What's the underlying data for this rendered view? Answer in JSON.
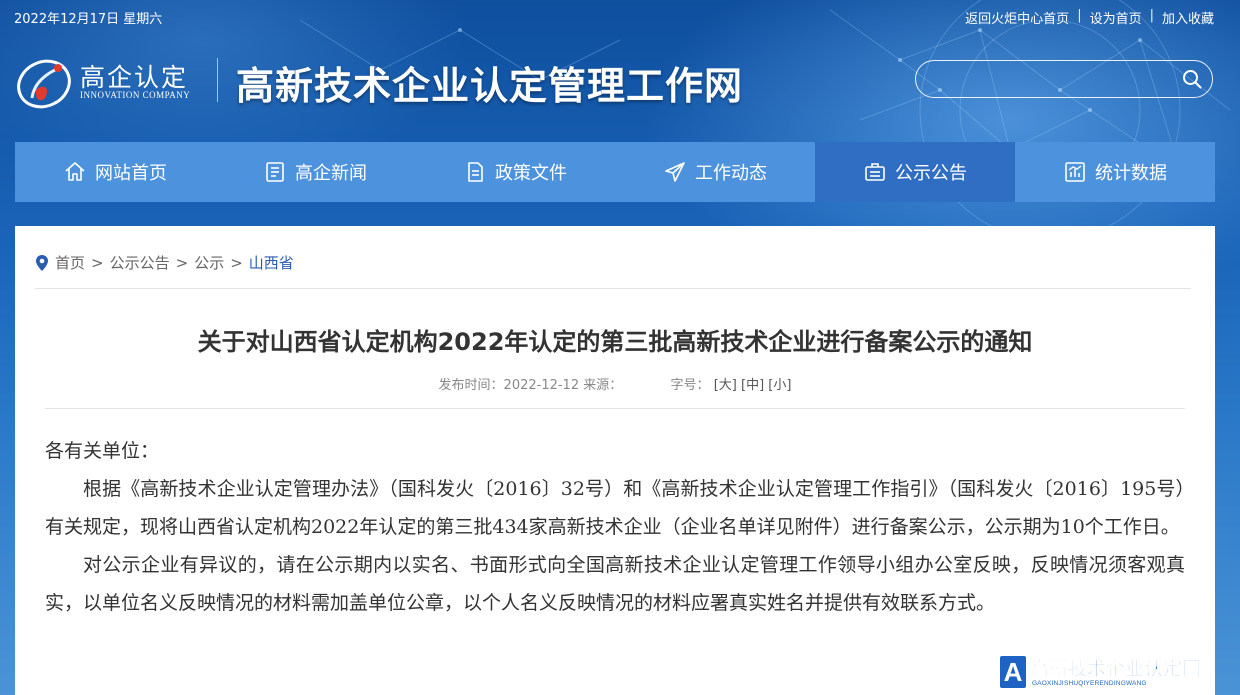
{
  "topbar": {
    "date": "2022年12月17日 星期六",
    "links": [
      "返回火炬中心首页",
      "设为首页",
      "加入收藏"
    ],
    "separator": "|"
  },
  "logo": {
    "cn": "高企认定",
    "en": "INNOVATION COMPANY"
  },
  "site_title": "高新技术企业认定管理工作网",
  "search": {
    "value": "",
    "placeholder": ""
  },
  "nav": {
    "items": [
      {
        "label": "网站首页",
        "icon": "home-icon"
      },
      {
        "label": "高企新闻",
        "icon": "news-icon"
      },
      {
        "label": "政策文件",
        "icon": "document-icon"
      },
      {
        "label": "工作动态",
        "icon": "send-icon"
      },
      {
        "label": "公示公告",
        "icon": "notice-icon"
      },
      {
        "label": "统计数据",
        "icon": "chart-icon"
      }
    ],
    "active_index": 4
  },
  "breadcrumb": {
    "items": [
      "首页",
      "公示公告",
      "公示",
      "山西省"
    ],
    "separator": ">"
  },
  "article": {
    "title": "关于对山西省认定机构2022年认定的第三批高新技术企业进行备案公示的通知",
    "meta": {
      "publish_label": "发布时间：",
      "publish_date": "2022-12-12",
      "source_label": "来源：",
      "source": "",
      "font_size_label": "字号：",
      "size_large": "[大]",
      "size_medium": "[中]",
      "size_small": "[小]"
    },
    "salutation": "各有关单位：",
    "paragraphs": [
      "根据《高新技术企业认定管理办法》（国科发火〔2016〕32号）和《高新技术企业认定管理工作指引》（国科发火〔2016〕195号）有关规定，现将山西省认定机构2022年认定的第三批434家高新技术企业（企业名单详见附件）进行备案公示，公示期为10个工作日。",
      "对公示企业有异议的，请在公示期内以实名、书面形式向全国高新技术企业认定管理工作领导小组办公室反映，反映情况须客观真实，以单位名义反映情况的材料需加盖单位公章，以个人名义反映情况的材料应署真实姓名并提供有效联系方式。"
    ]
  },
  "watermark": {
    "letter": "A",
    "title": "高新技术企业认定网",
    "subtitle": "GAOXINJISHUQIYERENDINGWANG"
  },
  "colors": {
    "header_bg": "#1a5aa8",
    "nav_bg": "#4d92dc",
    "nav_active": "#2f6ec2",
    "breadcrumb_current": "#2a5db0",
    "watermark": "#1e63c4"
  }
}
